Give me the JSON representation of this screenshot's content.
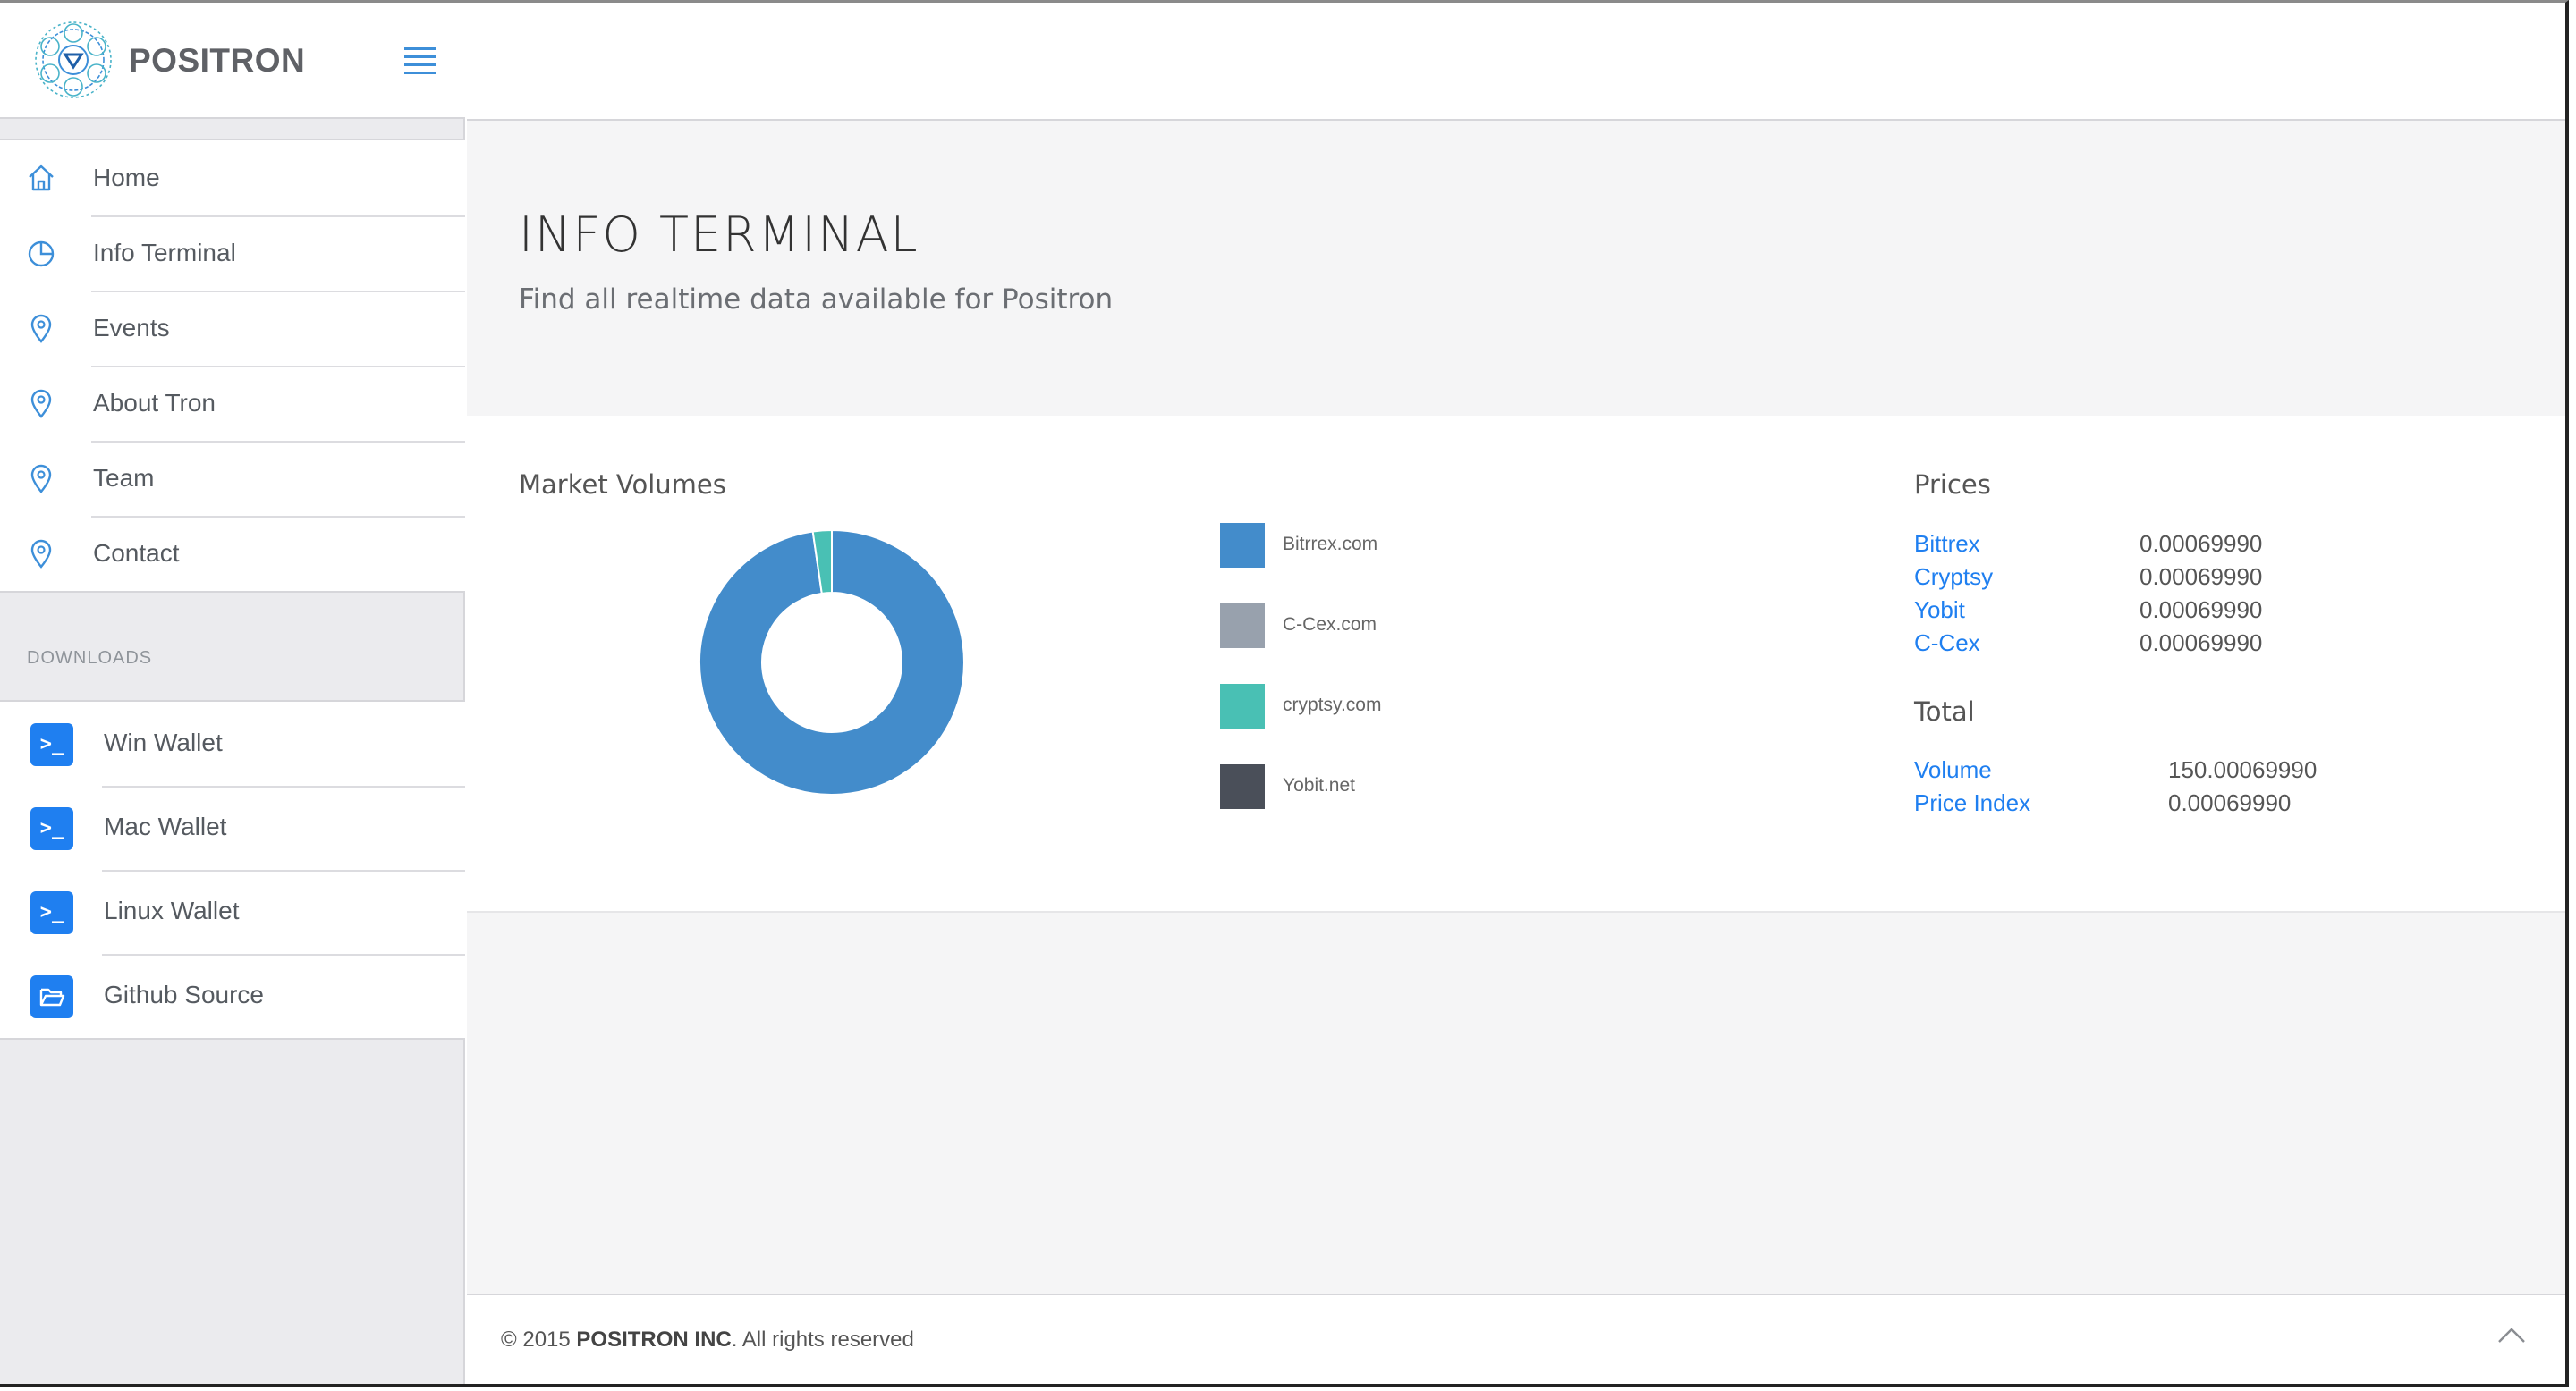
{
  "brand": {
    "name": "POSITRON"
  },
  "sidebar": {
    "nav_items": [
      {
        "label": "Home",
        "icon": "home-icon"
      },
      {
        "label": "Info Terminal",
        "icon": "pie-chart-icon"
      },
      {
        "label": "Events",
        "icon": "map-pin-icon"
      },
      {
        "label": "About Tron",
        "icon": "map-pin-icon"
      },
      {
        "label": "Team",
        "icon": "map-pin-icon"
      },
      {
        "label": "Contact",
        "icon": "map-pin-icon"
      }
    ],
    "downloads_header": "DOWNLOADS",
    "downloads": [
      {
        "label": "Win Wallet",
        "icon": "terminal-icon",
        "glyph": ">_"
      },
      {
        "label": "Mac Wallet",
        "icon": "terminal-icon",
        "glyph": ">_"
      },
      {
        "label": "Linux Wallet",
        "icon": "terminal-icon",
        "glyph": ">_"
      },
      {
        "label": "Github Source",
        "icon": "folder-open-icon",
        "glyph": ""
      }
    ]
  },
  "header": {
    "title": "INFO TERMINAL",
    "subtitle": "Find all realtime data available for Positron"
  },
  "market_volumes": {
    "title": "Market Volumes",
    "legend": [
      {
        "label": "Bitrrex.com",
        "color": "#438ccb"
      },
      {
        "label": "C-Cex.com",
        "color": "#98a1ad"
      },
      {
        "label": "cryptsy.com",
        "color": "#49c0b4"
      },
      {
        "label": "Yobit.net",
        "color": "#4a4f59"
      }
    ]
  },
  "chart_data": {
    "type": "pie",
    "title": "Market Volumes",
    "categories": [
      "Bitrrex.com",
      "C-Cex.com",
      "cryptsy.com",
      "Yobit.net"
    ],
    "values": [
      97.7,
      0,
      2.3,
      0
    ],
    "colors": [
      "#438ccb",
      "#98a1ad",
      "#49c0b4",
      "#4a4f59"
    ],
    "donut": true
  },
  "prices": {
    "title": "Prices",
    "rows": [
      {
        "name": "Bittrex",
        "value": "0.00069990"
      },
      {
        "name": "Cryptsy",
        "value": "0.00069990"
      },
      {
        "name": "Yobit",
        "value": "0.00069990"
      },
      {
        "name": "C-Cex",
        "value": "0.00069990"
      }
    ]
  },
  "total": {
    "title": "Total",
    "rows": [
      {
        "name": "Volume",
        "value": "150.00069990"
      },
      {
        "name": "Price Index",
        "value": "0.00069990"
      }
    ]
  },
  "footer": {
    "prefix": "© 2015 ",
    "company": "POSITRON INC",
    "suffix": ". All rights reserved"
  }
}
